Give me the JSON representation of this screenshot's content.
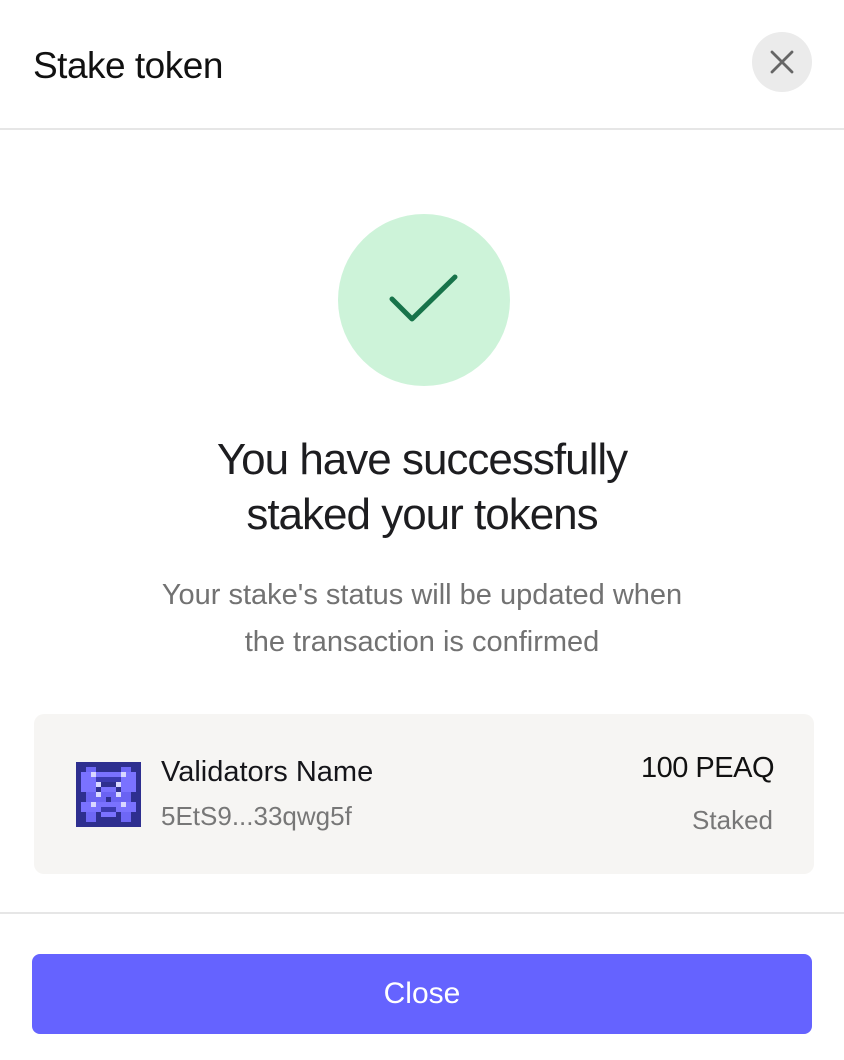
{
  "header": {
    "title": "Stake token"
  },
  "success": {
    "headline_line1": "You have successfully",
    "headline_line2": "staked your tokens",
    "subtext_line1": "Your stake's status will be updated when",
    "subtext_line2": "the transaction is confirmed",
    "icon": "checkmark-icon"
  },
  "validator": {
    "name": "Validators Name",
    "address": "5EtS9...33qwg5f",
    "amount": "100 PEAQ",
    "status": "Staked",
    "avatar_icon": "pixel-avatar-icon"
  },
  "footer": {
    "close_label": "Close"
  },
  "colors": {
    "accent": "#6563ff",
    "success_bg": "#cdf3d9",
    "success_check": "#17734a",
    "card_bg": "#f6f5f3"
  }
}
